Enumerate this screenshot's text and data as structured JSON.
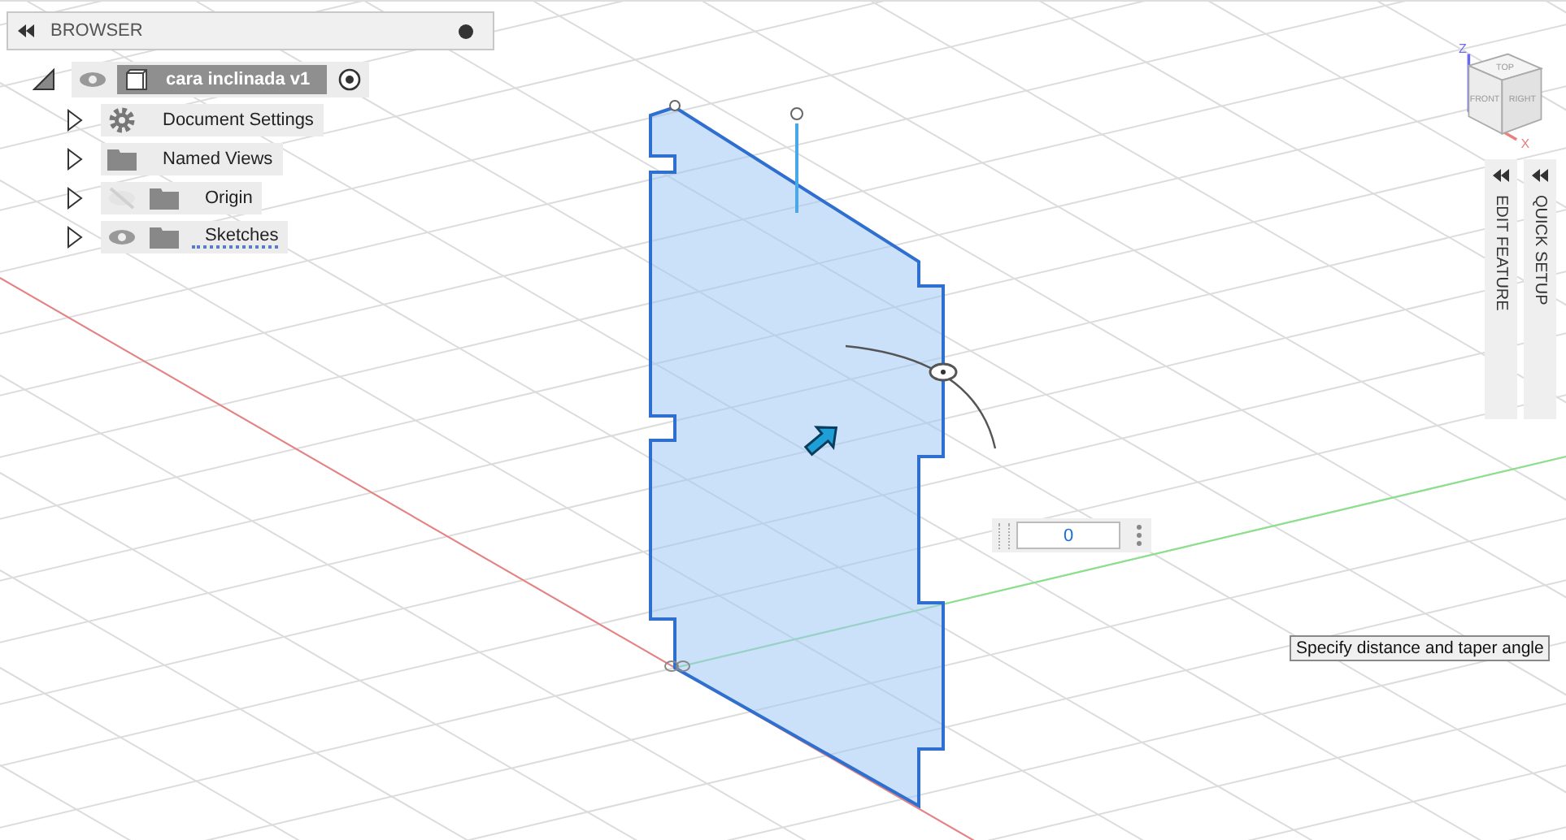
{
  "browser": {
    "title": "BROWSER",
    "root": {
      "label": "cara inclinada v1",
      "expanded": true,
      "visible": true,
      "children": [
        {
          "label": "Document Settings",
          "kind": "settings",
          "expanded": false
        },
        {
          "label": "Named Views",
          "kind": "folder",
          "expanded": false
        },
        {
          "label": "Origin",
          "kind": "folder",
          "expanded": false,
          "visible": false
        },
        {
          "label": "Sketches",
          "kind": "sketches",
          "expanded": false,
          "visible": true
        }
      ]
    }
  },
  "viewcube": {
    "faces": [
      "TOP",
      "FRONT",
      "RIGHT"
    ],
    "axes": [
      "Z",
      "X"
    ]
  },
  "side_panels": [
    {
      "label": "EDIT FEATURE"
    },
    {
      "label": "QUICK SETUP"
    }
  ],
  "input": {
    "value": "0"
  },
  "tooltip": "Specify distance and taper angle"
}
